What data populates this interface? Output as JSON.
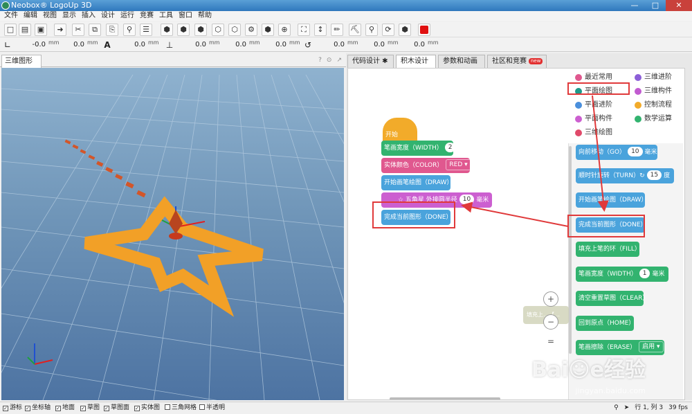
{
  "window": {
    "title": "Neobox® LogoUp 3D"
  },
  "menu": [
    "文件",
    "编辑",
    "视图",
    "显示",
    "插入",
    "设计",
    "运行",
    "竞赛",
    "工具",
    "窗口",
    "帮助"
  ],
  "toolbar": {
    "icons": [
      "new-icon",
      "open-icon",
      "save-icon",
      "export-icon",
      "cut-icon",
      "copy-icon",
      "paste-icon",
      "search-icon",
      "list-icon",
      "cube-icon",
      "cube-icon",
      "cube-icon",
      "cube-icon",
      "cube-icon",
      "gear-icon",
      "cube-icon",
      "axis-icon",
      "fit-view-icon",
      "bottle-icon",
      "pen-icon",
      "paint-icon",
      "pin-icon",
      "rotate-cube-icon",
      "box-icon",
      "stop-icon"
    ],
    "stop_color": "#e01010"
  },
  "coords": {
    "g1": {
      "values": [
        "-0.0",
        "0.0"
      ],
      "unit": "mm"
    },
    "g2": {
      "values": [
        "0.0"
      ],
      "unit": "mm"
    },
    "g3": {
      "values": [
        "0.0",
        "0.0",
        "0.0"
      ],
      "unit": "mm"
    },
    "g4": {
      "values": [
        "0.0",
        "0.0",
        "0.0"
      ],
      "unit": "mm"
    }
  },
  "left": {
    "tab": "三维图形",
    "tab_icons": [
      "?",
      "⊙",
      "↗"
    ]
  },
  "right": {
    "tabs": [
      "代码设计 ✱",
      "积木设计",
      "参数和动画",
      "社区和竞赛"
    ],
    "new_badge": "new",
    "categories": [
      {
        "label": "最近常用",
        "color": "#e0588f"
      },
      {
        "label": "三维进阶",
        "color": "#8c5fd8"
      },
      {
        "label": "平面绘图",
        "color": "#1e9a8a"
      },
      {
        "label": "三维构件",
        "color": "#c15bd0"
      },
      {
        "label": "平面进阶",
        "color": "#4a8fdc"
      },
      {
        "label": "控制流程",
        "color": "#f2ab2a"
      },
      {
        "label": "平面构件",
        "color": "#cc5fd0"
      },
      {
        "label": "数学运算",
        "color": "#32b36f"
      },
      {
        "label": "三维绘图",
        "color": "#e04a6a"
      }
    ],
    "workspace": {
      "start": "开始",
      "width_label": "笔画宽度（WIDTH）",
      "width_value": "2",
      "width_unit": "毫米",
      "color_label": "实体颜色（COLOR）",
      "color_value": "RED",
      "draw_label": "开始画笔绘图（DRAW）",
      "star_label": "☆ 五角星 外接圆半径",
      "star_value": "10",
      "star_unit": "毫米",
      "done_label": "完成当前图形（DONE）"
    },
    "flyout": {
      "go_label": "向前移动（GO）",
      "go_value": "10",
      "go_unit": "毫米",
      "turn_label": "顺时针旋转（TURN）↻",
      "turn_value": "15",
      "turn_unit": "度",
      "draw_label": "开始画笔绘图（DRAW）",
      "done_label": "完成当前图形（DONE）",
      "fill_label": "填充上笔的环（FILL）",
      "width_label": "笔画宽度（WIDTH）",
      "width_value": "1",
      "width_unit": "毫米",
      "clear_label": "清空重置草图（CLEAR）",
      "home_label": "回到原点（HOME）",
      "erase_label": "笔画擦除（ERASE）",
      "erase_value": "启用"
    },
    "ghost_label": "填充上…【…"
  },
  "zoom": {
    "in": "+",
    "out": "−",
    "reset": "="
  },
  "status": {
    "items": [
      "游标",
      "坐标轴",
      "地面",
      "草图",
      "草图面",
      "实体图",
      "三角网格",
      "半透明"
    ],
    "checked": [
      true,
      true,
      true,
      true,
      true,
      true,
      false,
      false
    ],
    "position": "行 1, 列 3",
    "fps": "39 fps"
  },
  "watermark": {
    "brand": "Bai☺e经验",
    "url": "jingyan.baidu.com"
  }
}
